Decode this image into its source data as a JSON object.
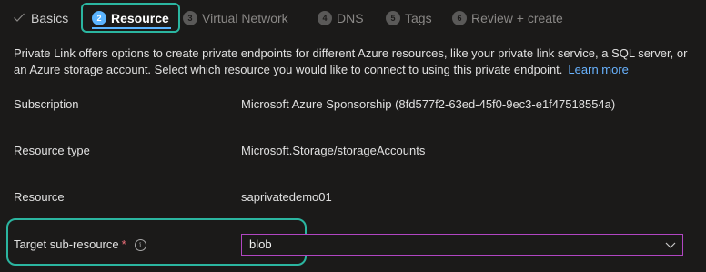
{
  "tabs": {
    "basics": "Basics",
    "resource": {
      "num": "2",
      "label": "Resource"
    },
    "virtual_network": {
      "num": "3",
      "label": "Virtual Network"
    },
    "dns": {
      "num": "4",
      "label": "DNS"
    },
    "tags": {
      "num": "5",
      "label": "Tags"
    },
    "review": {
      "num": "6",
      "label": "Review + create"
    }
  },
  "intro": {
    "text": "Private Link offers options to create private endpoints for different Azure resources, like your private link service, a SQL server, or an Azure storage account. Select which resource you would like to connect to using this private endpoint.",
    "learn_more": "Learn more"
  },
  "fields": {
    "subscription": {
      "label": "Subscription",
      "value": "Microsoft Azure Sponsorship (8fd577f2-63ed-45f0-9ec3-e1f47518554a)"
    },
    "resource_type": {
      "label": "Resource type",
      "value": "Microsoft.Storage/storageAccounts"
    },
    "resource": {
      "label": "Resource",
      "value": "saprivatedemo01"
    },
    "target_sub_resource": {
      "label": "Target sub-resource",
      "required_mark": "*",
      "info_glyph": "i",
      "value": "blob"
    }
  },
  "colors": {
    "background": "#1b1a19",
    "highlight_outline": "#2bb5a0",
    "active_tab_accent": "#5bb4ff",
    "link": "#69b3ff",
    "select_border": "#b146c2",
    "required": "#f1707b"
  },
  "icons": {
    "completed_step": "checkmark-icon",
    "info": "info-icon",
    "dropdown": "chevron-down-icon"
  }
}
